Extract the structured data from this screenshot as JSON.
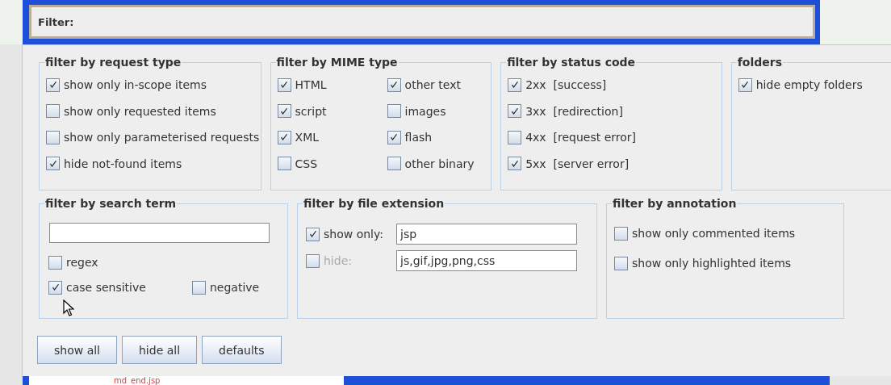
{
  "filter_bar": {
    "label": "Filter:"
  },
  "groups": [
    {
      "title": "filter by request type",
      "items": [
        {
          "label": "show only in-scope items",
          "checked": true
        },
        {
          "label": "show only requested items",
          "checked": false
        },
        {
          "label": "show only parameterised requests",
          "checked": false
        },
        {
          "label": "hide not-found items",
          "checked": true
        }
      ]
    },
    {
      "title": "filter by MIME type",
      "items": [
        {
          "label": "HTML",
          "checked": true
        },
        {
          "label": "other text",
          "checked": true
        },
        {
          "label": "script",
          "checked": true
        },
        {
          "label": "images",
          "checked": false
        },
        {
          "label": "XML",
          "checked": true
        },
        {
          "label": "flash",
          "checked": true
        },
        {
          "label": "CSS",
          "checked": false
        },
        {
          "label": "other binary",
          "checked": false
        }
      ]
    },
    {
      "title": "filter by status code",
      "items": [
        {
          "label": "2xx  [success]",
          "checked": true
        },
        {
          "label": "3xx  [redirection]",
          "checked": true
        },
        {
          "label": "4xx  [request error]",
          "checked": false
        },
        {
          "label": "5xx  [server error]",
          "checked": true
        }
      ]
    },
    {
      "title": "folders",
      "items": [
        {
          "label": "hide empty folders",
          "checked": true
        }
      ]
    }
  ],
  "search": {
    "title": "filter by search term",
    "options": [
      {
        "label": "regex",
        "checked": false
      },
      {
        "label": "case sensitive",
        "checked": true
      },
      {
        "label": "negative",
        "checked": false
      }
    ]
  },
  "file_extension": {
    "title": "filter by file extension",
    "rows": [
      {
        "label": "show only:",
        "checked": true,
        "value": "jsp"
      },
      {
        "label": "hide:",
        "checked": false,
        "value": "js,gif,jpg,png,css"
      }
    ]
  },
  "annotation": {
    "title": "filter by annotation",
    "items": [
      {
        "label": "show only commented items",
        "checked": false
      },
      {
        "label": "show only highlighted items",
        "checked": false
      }
    ]
  },
  "buttons": [
    "show all",
    "hide all",
    "defaults"
  ],
  "tree_item": {
    "label": "md_end.jsp"
  }
}
